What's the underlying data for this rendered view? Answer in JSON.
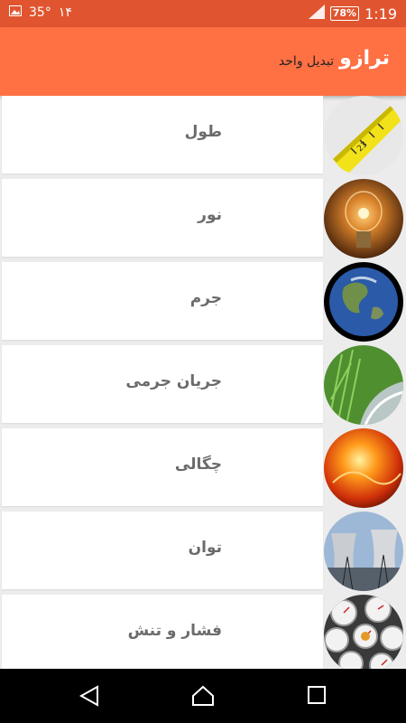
{
  "status_bar": {
    "temperature": "35°",
    "date_num": "۱۴",
    "battery": "78%",
    "time": "1:19"
  },
  "app_bar": {
    "title": "ترازو",
    "subtitle": "تبدیل واحد"
  },
  "items": [
    {
      "label": "طول",
      "icon": "tape-measure"
    },
    {
      "label": "نور",
      "icon": "light-bulb"
    },
    {
      "label": "جرم",
      "icon": "earth-globe"
    },
    {
      "label": "جریان جرمی",
      "icon": "grass-water"
    },
    {
      "label": "چگالی",
      "icon": "sun-surface"
    },
    {
      "label": "توان",
      "icon": "power-plant"
    },
    {
      "label": "فشار و تنش",
      "icon": "pressure-gauges"
    }
  ],
  "colors": {
    "app_bar": "#ff7043",
    "status_bar": "#e0552f",
    "label_text": "#6b6b6b"
  }
}
